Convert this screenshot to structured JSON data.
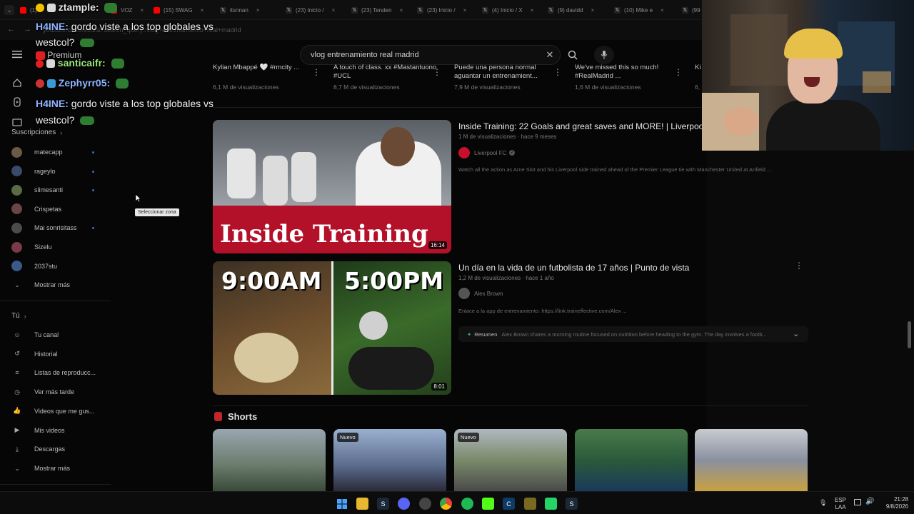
{
  "tabs": [
    {
      "icon_color": "#ff0000",
      "label": "(1) F"
    },
    {
      "icon_color": "#ff0000",
      "label": "VOZ"
    },
    {
      "icon_color": "#ff0000",
      "label": "(15) SWAG"
    },
    {
      "icon_color": "#000000",
      "label": "itsnnan"
    },
    {
      "icon_color": "#000000",
      "label": "(23) Inicio /"
    },
    {
      "icon_color": "#000000",
      "label": "(23) Tenden"
    },
    {
      "icon_color": "#000000",
      "label": "(23) Inicio /"
    },
    {
      "icon_color": "#000000",
      "label": "(4) Inicio / X"
    },
    {
      "icon_color": "#000000",
      "label": "(9) davidd"
    },
    {
      "icon_color": "#000000",
      "label": "(10) Mike e"
    },
    {
      "icon_color": "#000000",
      "label": "(99"
    }
  ],
  "address": "youtube.com/results?search_query=vlog+entrenamiento+real+madrid",
  "search": {
    "query": "vlog entrenamiento real madrid"
  },
  "chat": [
    {
      "user": "ztample:",
      "text": ""
    },
    {
      "user": "H4INE:",
      "text": "gordo viste a los top globales vs"
    },
    {
      "user": "",
      "text": "westcol?"
    },
    {
      "user": "Premium",
      "text": ""
    },
    {
      "user": "santicaifr:",
      "text": ""
    },
    {
      "user": "Zephyrr05:",
      "text": ""
    },
    {
      "user": "H4INE:",
      "text": "gordo viste a los top globales vs"
    },
    {
      "user": "",
      "text": "westcol?"
    }
  ],
  "sidebar": {
    "subs_header": "Suscripciones",
    "subs": [
      {
        "name": "matecapp",
        "color": "#6b5a45",
        "live": true
      },
      {
        "name": "rageylo",
        "color": "#3b4a6b",
        "live": true
      },
      {
        "name": "slimesanti",
        "color": "#5a6b45",
        "live": true
      },
      {
        "name": "Crispetas",
        "color": "#6b4545",
        "live": false
      },
      {
        "name": "Mai sonrisitass",
        "color": "#4b4b4b",
        "live": true
      },
      {
        "name": "Sizelu",
        "color": "#7a3a4a",
        "live": false
      },
      {
        "name": "2037stu",
        "color": "#3a5a8a",
        "live": false
      }
    ],
    "show_more": "Mostrar más",
    "you_header": "Tú",
    "you_items": [
      {
        "label": "Tu canal",
        "icon": "channel-icon"
      },
      {
        "label": "Historial",
        "icon": "history-icon"
      },
      {
        "label": "Listas de reproducc...",
        "icon": "playlist-icon"
      },
      {
        "label": "Ver más tarde",
        "icon": "clock-icon"
      },
      {
        "label": "Videos que me gus...",
        "icon": "like-icon"
      },
      {
        "label": "Mis videos",
        "icon": "my-videos-icon"
      },
      {
        "label": "Descargas",
        "icon": "download-icon"
      }
    ],
    "show_more_2": "Mostrar más"
  },
  "tooltip": "Seleccionar zona",
  "top_row": [
    {
      "title": "Kylian Mbappé 🤍 #rmcity ...",
      "views": "6,1 M de visualizaciones"
    },
    {
      "title": "A touch of class. xx #Mastantuono #UCL",
      "views": "8,7 M de visualizaciones"
    },
    {
      "title": "Puede una persona normal aguantar un entrenamient...",
      "views": "7,9 M de visualizaciones"
    },
    {
      "title": "We've missed this so much! #RealMadrid ...",
      "views": "1,6 M de visualizaciones"
    },
    {
      "title": "Ki",
      "views": "6,"
    }
  ],
  "videos": [
    {
      "title": "Inside Training: 22 Goals and great saves and MORE! | Liverpool",
      "meta": "1 M de visualizaciones · hace 9 meses",
      "channel": "Liverpool FC",
      "desc": "Watch all the action as Arne Slot and his Liverpool side trained ahead of the Premier League tie with Manchester United at Anfield ...",
      "duration": "16:14",
      "thumb_text": "Inside Training"
    },
    {
      "title": "Un día en la vida de un futbolista de 17 años | Punto de vista",
      "meta": "1,2 M de visualizaciones · hace 1 año",
      "channel": "Alex Brown",
      "desc": "Enlace a la app de entrenamiento: https://link.traineffective.com/Alex ...",
      "duration": "8:01",
      "thumb_left": "9:00AM",
      "thumb_right": "5:00PM",
      "summary_label": "Resumen",
      "summary_text": "Alex Brown shares a morning routine focused on nutrition before heading to the gym. The day involves a footb..."
    }
  ],
  "shorts": {
    "header": "Shorts",
    "badge": "Nuevo"
  },
  "taskbar": {
    "lang1": "ESP",
    "lang2": "LAA",
    "time": "21:28",
    "date": "9/8/2026"
  }
}
